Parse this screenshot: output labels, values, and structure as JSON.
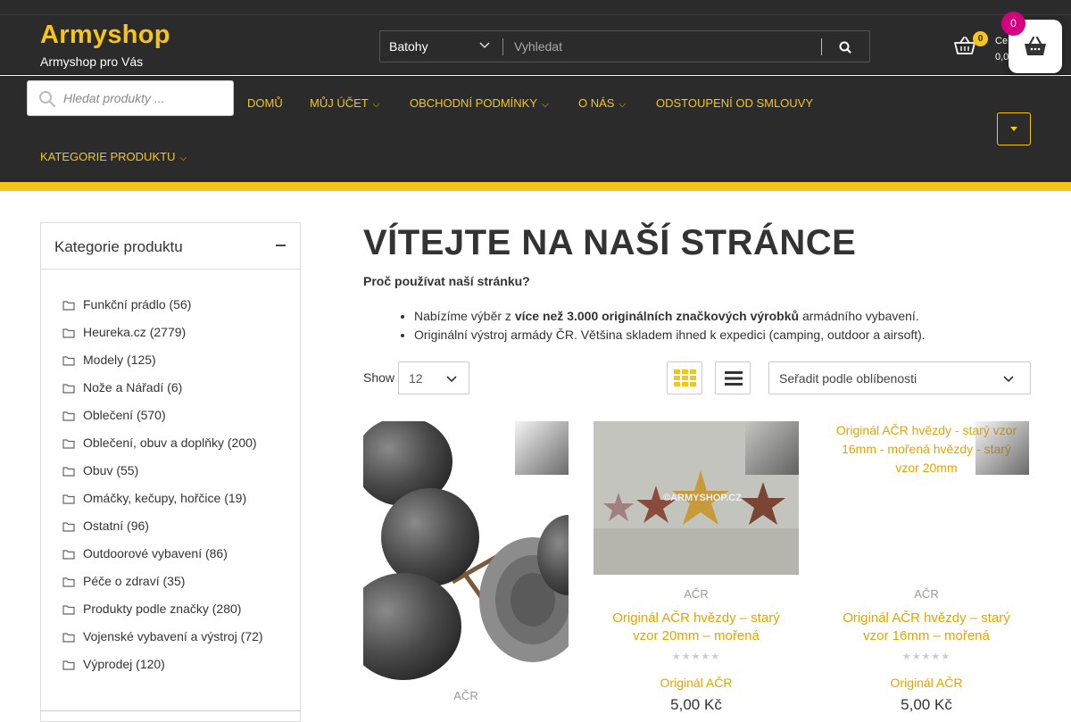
{
  "header": {
    "logo": "Armyshop",
    "tagline": "Armyshop pro Vás",
    "search": {
      "category": "Batohy",
      "placeholder": "Vyhledat"
    },
    "cart": {
      "count": "0",
      "label": "Ce",
      "total": "0,0",
      "floating_count": "0"
    }
  },
  "nav": {
    "product_search_placeholder": "Hledat produkty ...",
    "items": [
      {
        "label": "DOMŮ"
      },
      {
        "label": "MŮJ ÚČET"
      },
      {
        "label": "OBCHODNÍ PODMÍNKY"
      },
      {
        "label": "O NÁS"
      },
      {
        "label": "ODSTOUPENÍ OD SMLOUVY"
      },
      {
        "label": "KATEGORIE PRODUKTU"
      }
    ]
  },
  "sidebar": {
    "title": "Kategorie produktu",
    "categories": [
      {
        "label": "Funkční prádlo",
        "count": "(56)"
      },
      {
        "label": "Heureka.cz",
        "count": "(2779)"
      },
      {
        "label": "Modely",
        "count": "(125)"
      },
      {
        "label": "Nože a Nářadí",
        "count": "(6)"
      },
      {
        "label": "Oblečení",
        "count": "(570)"
      },
      {
        "label": "Oblečení, obuv a doplňky",
        "count": "(200)"
      },
      {
        "label": "Obuv",
        "count": "(55)"
      },
      {
        "label": "Omáčky, kečupy, hořčice",
        "count": "(19)"
      },
      {
        "label": "Ostatní",
        "count": "(96)"
      },
      {
        "label": "Outdoorové vybavení",
        "count": "(86)"
      },
      {
        "label": "Péče o zdraví",
        "count": "(35)"
      },
      {
        "label": "Produkty podle značky",
        "count": "(280)"
      },
      {
        "label": "Vojenské vybavení a výstroj",
        "count": "(72)"
      },
      {
        "label": "Výprodej",
        "count": "(120)"
      }
    ]
  },
  "main": {
    "title": "VÍTEJTE NA NAŠÍ STRÁNCE",
    "question": "Proč používat naší stránku?",
    "bullet1_pre": "Nabízíme výběr z ",
    "bullet1_bold": "více než 3.000 originálních značkových výrobků",
    "bullet1_post": " armádního vybavení.",
    "bullet2": "Originální výstroj armády ČR. Většina skladem ihned k expedici (camping, outdoor a airsoft).",
    "show_label": "Show",
    "show_value": "12",
    "sort_value": "Seřadit podle oblíbenosti"
  },
  "products": [
    {
      "brand": "AČR",
      "name": "",
      "subname": "",
      "price": "",
      "alt": ""
    },
    {
      "brand": "AČR",
      "name": "Originál AČR hvězdy – starý vzor 20mm – mořená",
      "subname": "Originál AČR",
      "price": "5,00 Kč",
      "alt": "",
      "stars": "★★★★★",
      "watermark": "©ARMYSHOP.CZ"
    },
    {
      "brand": "AČR",
      "name": "Originál AČR hvězdy – starý vzor 16mm – mořená",
      "subname": "Originál AČR",
      "price": "5,00 Kč",
      "alt": "Originál AČR hvězdy - starý vzor 16mm - mořená hvězdy - starý vzor 20mm",
      "stars": "★★★★★"
    }
  ],
  "colors": {
    "header_bg": "#2b2b2b",
    "accent_yellow": "#f5c518",
    "link_orange": "#e8a200",
    "badge_pink": "#d40080"
  }
}
